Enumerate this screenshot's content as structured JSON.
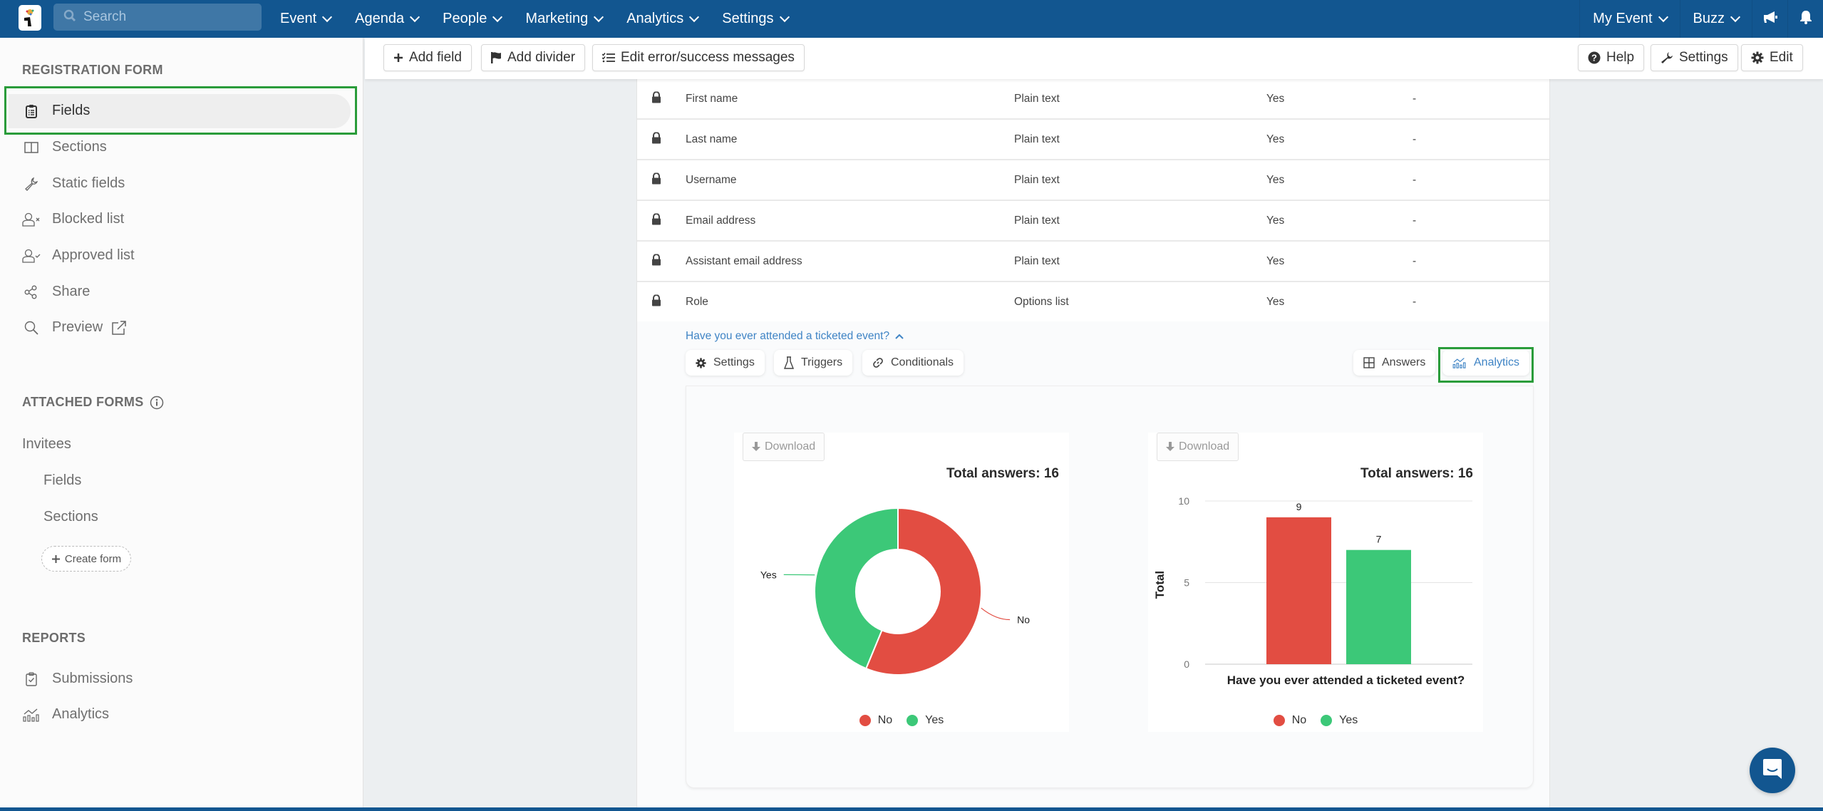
{
  "topnav": {
    "search_placeholder": "Search",
    "menu": [
      "Event",
      "Agenda",
      "People",
      "Marketing",
      "Analytics",
      "Settings"
    ],
    "right": {
      "event_switcher": "My Event",
      "buzz": "Buzz"
    },
    "icons": {
      "logo": "app-logo",
      "announce": "megaphone-icon",
      "notifications": "bell-icon"
    }
  },
  "toolbar": {
    "add_field": "Add field",
    "add_divider": "Add divider",
    "edit_messages": "Edit error/success messages",
    "help": "Help",
    "settings": "Settings",
    "edit": "Edit"
  },
  "sidebar": {
    "registration_heading": "REGISTRATION FORM",
    "items": [
      {
        "label": "Fields",
        "icon": "clipboard-list-icon",
        "active": true
      },
      {
        "label": "Sections",
        "icon": "columns-icon"
      },
      {
        "label": "Static fields",
        "icon": "wrench-icon"
      },
      {
        "label": "Blocked list",
        "icon": "user-x-icon"
      },
      {
        "label": "Approved list",
        "icon": "user-check-icon"
      },
      {
        "label": "Share",
        "icon": "share-icon"
      },
      {
        "label": "Preview",
        "icon": "search-icon"
      }
    ],
    "attached_heading": "ATTACHED FORMS",
    "attached_form": "Invitees",
    "attached_items": [
      "Fields",
      "Sections"
    ],
    "create_form": "Create form",
    "reports_heading": "REPORTS",
    "reports": [
      {
        "label": "Submissions",
        "icon": "clipboard-check-icon"
      },
      {
        "label": "Analytics",
        "icon": "analytics-icon"
      }
    ]
  },
  "fields_table": {
    "rows": [
      {
        "name": "First name",
        "type": "Plain text",
        "required": "Yes",
        "extra": "-"
      },
      {
        "name": "Last name",
        "type": "Plain text",
        "required": "Yes",
        "extra": "-"
      },
      {
        "name": "Username",
        "type": "Plain text",
        "required": "Yes",
        "extra": "-"
      },
      {
        "name": "Email address",
        "type": "Plain text",
        "required": "Yes",
        "extra": "-"
      },
      {
        "name": "Assistant email address",
        "type": "Plain text",
        "required": "Yes",
        "extra": "-"
      },
      {
        "name": "Role",
        "type": "Options list",
        "required": "Yes",
        "extra": "-"
      }
    ]
  },
  "question": {
    "title": "Have you ever attended a ticketed event?",
    "tabs_left": [
      "Settings",
      "Triggers",
      "Conditionals"
    ],
    "tabs_right": [
      "Answers",
      "Analytics"
    ],
    "active_tab": "Analytics"
  },
  "colors": {
    "no": "#e24d42",
    "yes": "#3cc878",
    "brand": "#125690",
    "highlight": "#2a9c3a"
  },
  "chart_data": [
    {
      "type": "pie",
      "variant": "donut",
      "download_label": "Download",
      "title": "Total answers: 16",
      "categories": [
        "No",
        "Yes"
      ],
      "values": [
        9,
        7
      ],
      "legend": [
        "No",
        "Yes"
      ],
      "legend_position": "bottom"
    },
    {
      "type": "bar",
      "download_label": "Download",
      "title": "Total answers: 16",
      "categories": [
        "No",
        "Yes"
      ],
      "values": [
        9,
        7
      ],
      "xlabel": "Have you ever attended a ticketed event?",
      "ylabel": "Total",
      "ylim": [
        0,
        10
      ],
      "yticks": [
        "0",
        "5",
        "10"
      ],
      "grid": true,
      "legend": [
        "No",
        "Yes"
      ],
      "legend_position": "bottom"
    }
  ]
}
